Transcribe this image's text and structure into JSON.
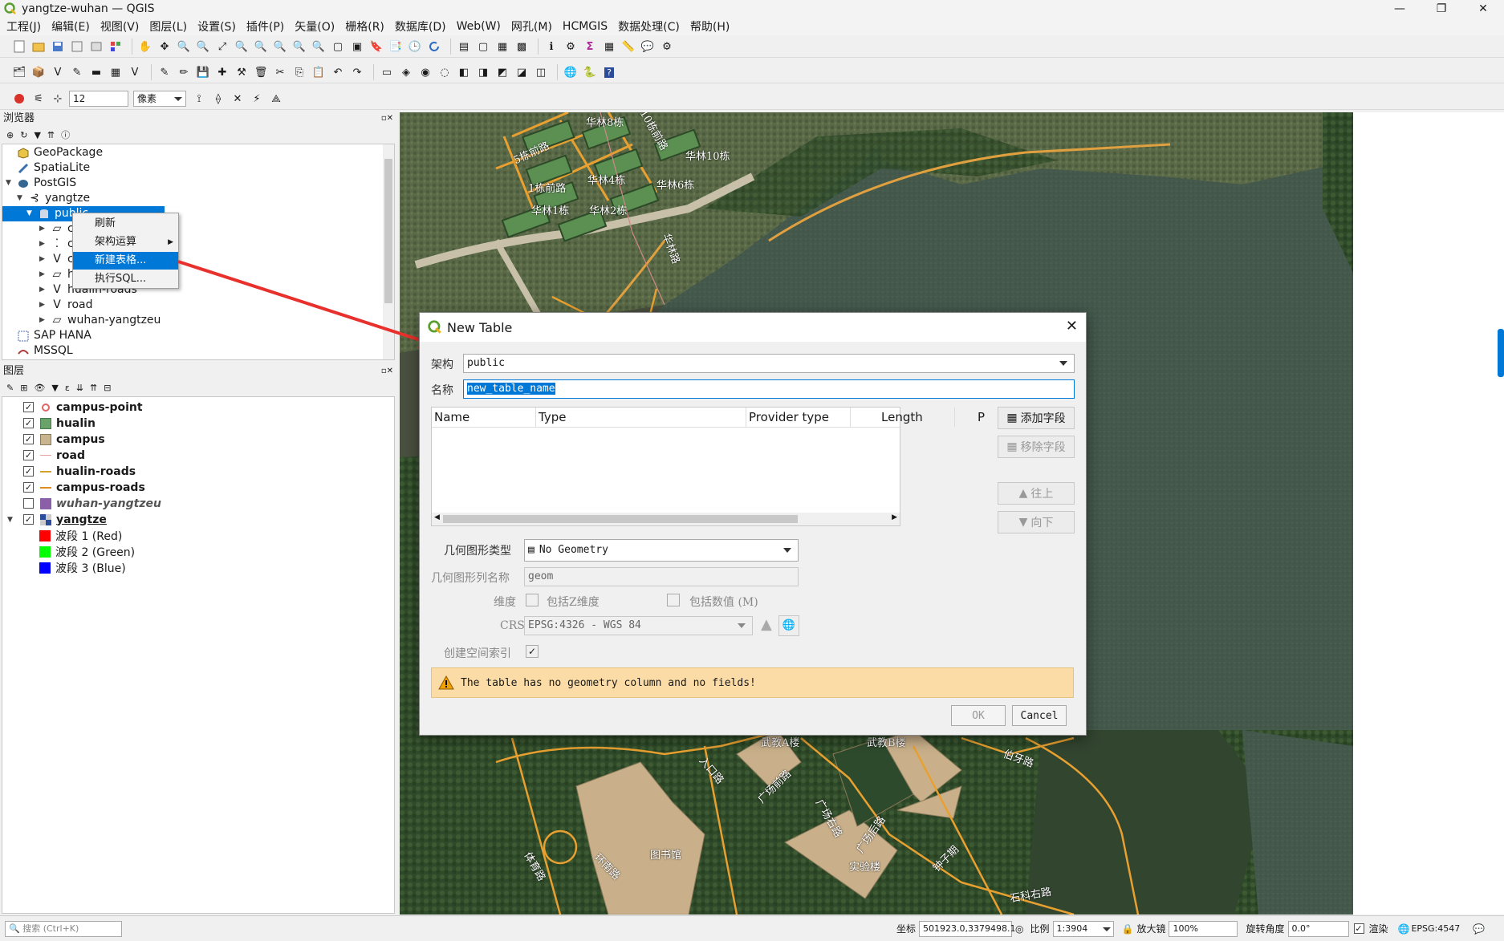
{
  "window": {
    "title": "yangtze-wuhan — QGIS"
  },
  "menu": [
    "工程(J)",
    "编辑(E)",
    "视图(V)",
    "图层(L)",
    "设置(S)",
    "插件(P)",
    "矢量(O)",
    "栅格(R)",
    "数据库(D)",
    "Web(W)",
    "网孔(M)",
    "HCMGIS",
    "数据处理(C)",
    "帮助(H)"
  ],
  "snapping": {
    "tolerance": "12",
    "unit": "像素"
  },
  "browser": {
    "title": "浏览器",
    "items": [
      {
        "label": "GeoPackage"
      },
      {
        "label": "SpatiaLite"
      },
      {
        "label": "PostGIS"
      },
      {
        "label": "yangtze"
      },
      {
        "label": "public"
      },
      {
        "label": "c"
      },
      {
        "label": "c"
      },
      {
        "label": "c"
      },
      {
        "label": "h"
      },
      {
        "label": "hualin-roads"
      },
      {
        "label": "road"
      },
      {
        "label": "wuhan-yangtzeu"
      },
      {
        "label": "SAP HANA"
      },
      {
        "label": "MSSQL"
      }
    ]
  },
  "context_menu": {
    "items": [
      "刷新",
      "架构运算",
      "新建表格...",
      "执行SQL..."
    ]
  },
  "layers": {
    "title": "图层",
    "items": [
      {
        "label": "campus-point",
        "color": "#e06666"
      },
      {
        "label": "hualin",
        "color": "#6aa36a"
      },
      {
        "label": "campus",
        "color": "#c8b590"
      },
      {
        "label": "road",
        "color": "#e6a0a0"
      },
      {
        "label": "hualin-roads",
        "color": "#d4a030"
      },
      {
        "label": "campus-roads",
        "color": "#e08a20"
      },
      {
        "label": "wuhan-yangtzeu",
        "color": "#8a5fa8"
      },
      {
        "label": "yangtze"
      },
      {
        "label": "波段 1 (Red)",
        "color": "#ff0000"
      },
      {
        "label": "波段 2 (Green)",
        "color": "#00ff00"
      },
      {
        "label": "波段 3 (Blue)",
        "color": "#0000ff"
      }
    ]
  },
  "map_labels": [
    "华林8栋",
    "10栋前路",
    "5栋前路",
    "华林10栋",
    "华林4栋",
    "华林2栋",
    "华林1栋",
    "1栋前路",
    "华林6栋",
    "华林路",
    "武教A楼",
    "武教B楼",
    "广场前路",
    "广场右路",
    "广场后路",
    "入口路",
    "图书馆",
    "环南路",
    "实验楼",
    "伯牙路",
    "钟子期",
    "石科右路",
    "体育路"
  ],
  "dialog": {
    "title": "New Table",
    "schema_label": "架构",
    "schema_value": "public",
    "name_label": "名称",
    "name_value": "new_table_name",
    "columns": [
      "Name",
      "Type",
      "Provider type",
      "Length",
      "P"
    ],
    "add_field": "添加字段",
    "remove_field": "移除字段",
    "move_up": "往上",
    "move_down": "向下",
    "geom_type_label": "几何图形类型",
    "geom_type_value": "No Geometry",
    "geom_col_label": "几何图形列名称",
    "geom_col_value": "geom",
    "dimensions_label": "维度",
    "include_z": "包括Z维度",
    "include_m": "包括数值 (M)",
    "crs_label": "CRS",
    "crs_value": "EPSG:4326 - WGS 84",
    "spatial_index_label": "创建空间索引",
    "warning": "The table has no geometry column and no fields!",
    "ok": "OK",
    "cancel": "Cancel"
  },
  "status": {
    "search_placeholder": "搜索 (Ctrl+K)",
    "coord_label": "坐标",
    "coord_value": "501923.0,3379498.1",
    "scale_label": "比例",
    "scale_value": "1:3904",
    "magnifier_label": "放大镜",
    "magnifier_value": "100%",
    "rotation_label": "旋转角度",
    "rotation_value": "0.0°",
    "render_label": "渲染",
    "crs": "EPSG:4547"
  },
  "colors": {
    "selection": "#0078d7",
    "warning_bg": "#fbdca6",
    "arrow": "#e8302c"
  }
}
